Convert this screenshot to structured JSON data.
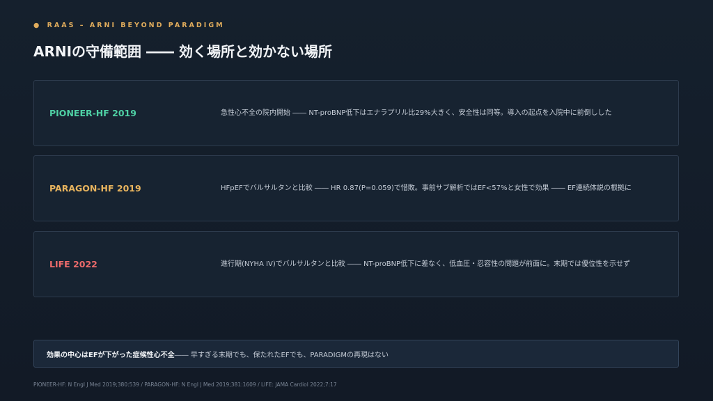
{
  "header": {
    "eyebrow_dot": "●",
    "eyebrow": "RAAS – ARNI BEYOND PARADIGM",
    "title": "ARNIの守備範囲 ―― 効く場所と効かない場所"
  },
  "cards": [
    {
      "name": "PIONEER-HF 2019",
      "color": "#4fd1a5",
      "desc": "急性心不全の院内開始 ―― NT-proBNP低下はエナラプリル比29%大きく、安全性は同等。導入の起点を入院中に前倒しした"
    },
    {
      "name": "PARAGON-HF 2019",
      "color": "#e8b45e",
      "desc": "HFpEFでバルサルタンと比較 ―― HR 0.87(P=0.059)で惜敗。事前サブ解析ではEF<57%と女性で効果 ―― EF連続体説の根拠に"
    },
    {
      "name": "LIFE 2022",
      "color": "#ee6b6b",
      "desc": "進行期(NYHA IV)でバルサルタンと比較 ―― NT-proBNP低下に差なく、低血圧・忍容性の問題が前面に。末期では優位性を示せず"
    }
  ],
  "summary": {
    "lead": "効果の中心はEFが下がった症候性心不全",
    "rest": " ―― 早すぎる末期でも、保たれたEFでも、PARADIGMの再現はない"
  },
  "footnote": "PIONEER-HF: N Engl J Med 2019;380:539 / PARAGON-HF: N Engl J Med 2019;381:1609 / LIFE: JAMA Cardiol 2022;7:17"
}
